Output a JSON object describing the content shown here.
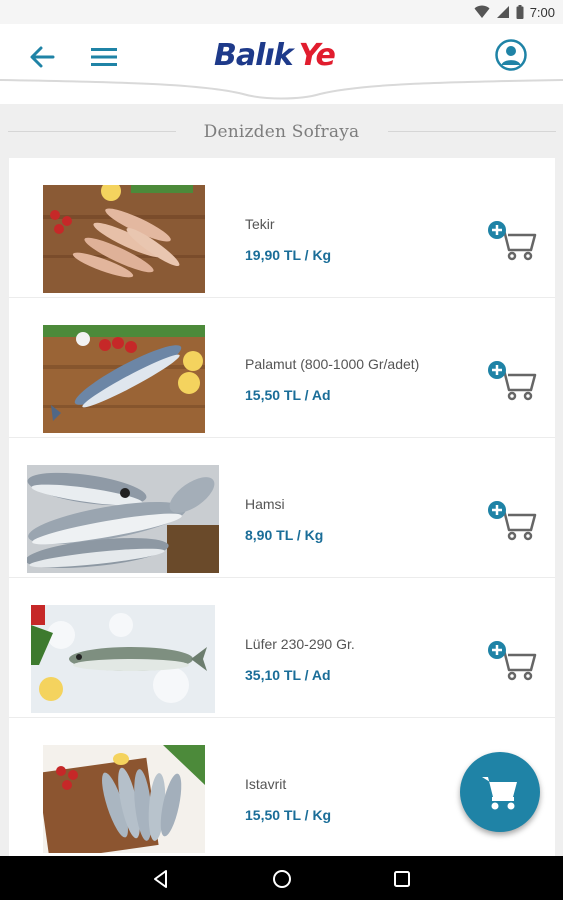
{
  "status_bar": {
    "time": "7:00"
  },
  "header": {
    "logo_part1": "Balık",
    "logo_part2": "Ye"
  },
  "section": {
    "title": "Denizden Sofraya"
  },
  "products": [
    {
      "name": "Tekir",
      "price": "19,90 TL / Kg"
    },
    {
      "name": "Palamut (800-1000 Gr/adet)",
      "price": "15,50 TL / Ad"
    },
    {
      "name": "Hamsi",
      "price": "8,90 TL / Kg"
    },
    {
      "name": "Lüfer 230-290 Gr.",
      "price": "35,10 TL / Ad"
    },
    {
      "name": "Istavrit",
      "price": "15,50 TL / Kg"
    }
  ],
  "colors": {
    "primary": "#1f83a6",
    "price": "#1a6d98",
    "logo_blue": "#1e3a8a",
    "logo_red": "#e11d2e"
  },
  "icons": {
    "back": "arrow-left-icon",
    "menu": "hamburger-icon",
    "profile": "account-circle-icon",
    "add_to_cart": "cart-plus-icon",
    "cart": "cart-icon"
  }
}
